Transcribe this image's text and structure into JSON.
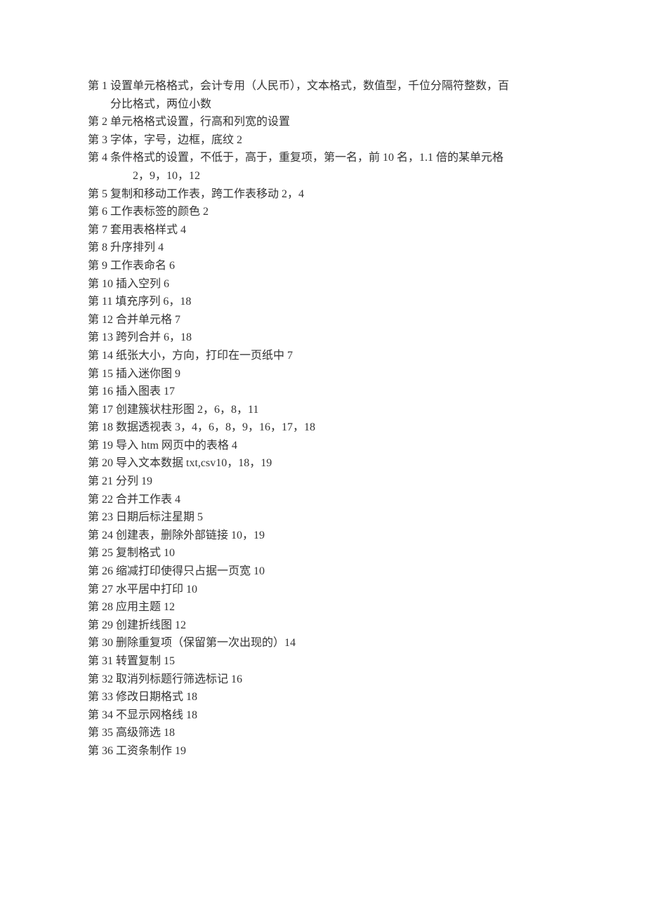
{
  "lines": [
    {
      "class": "line",
      "text": "第 1 设置单元格格式，会计专用（人民币），文本格式，数值型，千位分隔符整数，百"
    },
    {
      "class": "line indent-1",
      "text": "分比格式，两位小数"
    },
    {
      "class": "line",
      "text": "第 2 单元格格式设置，行高和列宽的设置"
    },
    {
      "class": "line",
      "text": "第 3 字体，字号，边框，底纹 2"
    },
    {
      "class": "line",
      "text": "第 4 条件格式的设置，不低于，高于，重复项，第一名，前 10 名，1.1 倍的某单元格"
    },
    {
      "class": "line indent-2",
      "text": "2，9，10，12"
    },
    {
      "class": "line",
      "text": "第 5 复制和移动工作表，跨工作表移动 2，4"
    },
    {
      "class": "line",
      "text": "第 6 工作表标签的颜色 2"
    },
    {
      "class": "line",
      "text": "第 7 套用表格样式 4"
    },
    {
      "class": "line",
      "text": "第 8 升序排列 4"
    },
    {
      "class": "line",
      "text": "第 9 工作表命名 6"
    },
    {
      "class": "line",
      "text": "第 10 插入空列 6"
    },
    {
      "class": "line",
      "text": "第 11 填充序列 6，18"
    },
    {
      "class": "line",
      "text": "第 12 合并单元格 7"
    },
    {
      "class": "line",
      "text": "第 13 跨列合并 6，18"
    },
    {
      "class": "line",
      "text": "第 14 纸张大小，方向，打印在一页纸中 7"
    },
    {
      "class": "line",
      "text": "第 15 插入迷你图 9"
    },
    {
      "class": "line",
      "text": "第 16 插入图表 17"
    },
    {
      "class": "line",
      "text": "第 17 创建簇状柱形图 2，6，8，11"
    },
    {
      "class": "line",
      "text": "第 18 数据透视表 3，4，6，8，9，16，17，18"
    },
    {
      "class": "line",
      "text": "第 19 导入 htm 网页中的表格 4"
    },
    {
      "class": "line",
      "text": "第 20 导入文本数据 txt,csv10，18，19"
    },
    {
      "class": "line",
      "text": "第 21 分列 19"
    },
    {
      "class": "line",
      "text": "第 22 合并工作表 4"
    },
    {
      "class": "line",
      "text": "第 23 日期后标注星期 5"
    },
    {
      "class": "line",
      "text": "第 24 创建表，删除外部链接 10，19"
    },
    {
      "class": "line",
      "text": "第 25 复制格式 10"
    },
    {
      "class": "line",
      "text": "第 26 缩减打印使得只占据一页宽 10"
    },
    {
      "class": "line",
      "text": "第 27 水平居中打印 10"
    },
    {
      "class": "line",
      "text": "第 28 应用主题 12"
    },
    {
      "class": "line",
      "text": "第 29 创建折线图 12"
    },
    {
      "class": "line",
      "text": "第 30 删除重复项（保留第一次出现的）14"
    },
    {
      "class": "line",
      "text": "第 31 转置复制 15"
    },
    {
      "class": "line",
      "text": "第 32 取消列标题行筛选标记 16"
    },
    {
      "class": "line",
      "text": "第 33 修改日期格式 18"
    },
    {
      "class": "line",
      "text": "第 34 不显示网格线 18"
    },
    {
      "class": "line",
      "text": "第 35 高级筛选 18"
    },
    {
      "class": "line",
      "text": "第 36 工资条制作 19"
    }
  ]
}
